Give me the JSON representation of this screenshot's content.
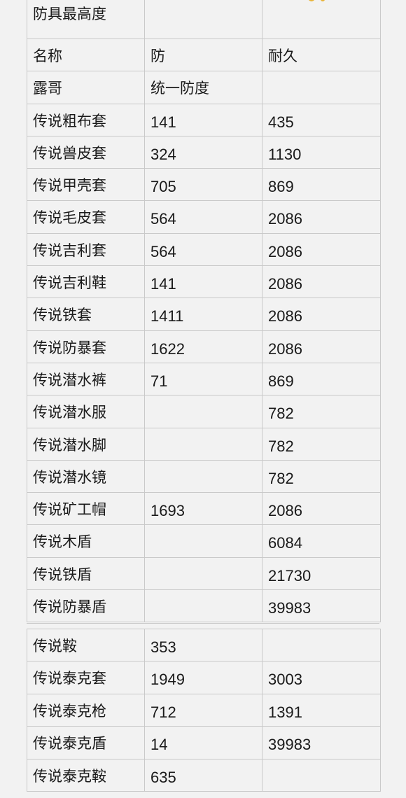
{
  "section1": {
    "rows": [
      [
        "防具最高度",
        "",
        ""
      ],
      [
        "名称",
        "防",
        "耐久"
      ],
      [
        "露哥",
        "统一防度",
        ""
      ],
      [
        "传说粗布套",
        "141",
        "435"
      ],
      [
        "传说兽皮套",
        "324",
        "1130"
      ],
      [
        "传说甲壳套",
        "705",
        "869"
      ],
      [
        "传说毛皮套",
        "564",
        "2086"
      ],
      [
        "传说吉利套",
        "564",
        "2086"
      ],
      [
        "传说吉利鞋",
        "141",
        "2086"
      ],
      [
        "传说铁套",
        "1411",
        "2086"
      ],
      [
        "传说防暴套",
        "1622",
        "2086"
      ],
      [
        "传说潜水裤",
        "71",
        "869"
      ],
      [
        "传说潜水服",
        "",
        "782"
      ],
      [
        "传说潜水脚",
        "",
        "782"
      ],
      [
        "传说潜水镜",
        "",
        "782"
      ],
      [
        "传说矿工帽",
        "1693",
        "2086"
      ],
      [
        "传说木盾",
        "",
        "6084"
      ],
      [
        "传说铁盾",
        "",
        "21730"
      ],
      [
        "传说防暴盾",
        "",
        "39983"
      ]
    ]
  },
  "section2": {
    "rows": [
      [
        "传说鞍",
        "353",
        ""
      ],
      [
        "传说泰克套",
        "1949",
        "3003"
      ],
      [
        "传说泰克枪",
        "712",
        "1391"
      ],
      [
        "传说泰克盾",
        "14",
        "39983"
      ],
      [
        "传说泰克鞍",
        "635",
        ""
      ]
    ]
  }
}
